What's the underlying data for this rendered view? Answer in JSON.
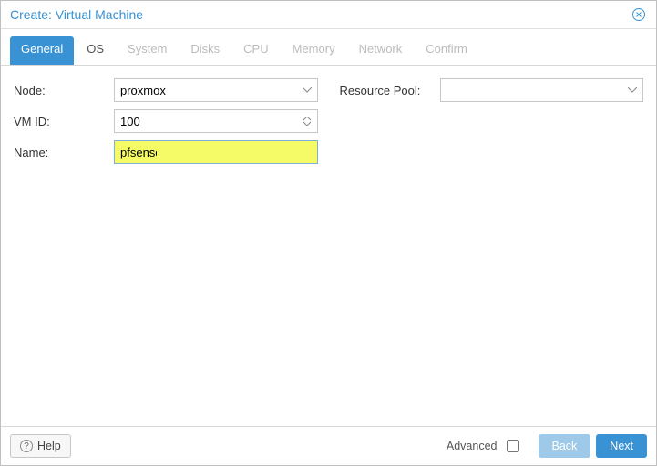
{
  "window": {
    "title": "Create: Virtual Machine"
  },
  "tabs": [
    {
      "label": "General",
      "active": true,
      "enabled": true
    },
    {
      "label": "OS",
      "active": false,
      "enabled": true
    },
    {
      "label": "System",
      "active": false,
      "enabled": false
    },
    {
      "label": "Disks",
      "active": false,
      "enabled": false
    },
    {
      "label": "CPU",
      "active": false,
      "enabled": false
    },
    {
      "label": "Memory",
      "active": false,
      "enabled": false
    },
    {
      "label": "Network",
      "active": false,
      "enabled": false
    },
    {
      "label": "Confirm",
      "active": false,
      "enabled": false
    }
  ],
  "form": {
    "node": {
      "label": "Node:",
      "value": "proxmox"
    },
    "vmid": {
      "label": "VM ID:",
      "value": "100"
    },
    "name": {
      "label": "Name:",
      "value": "pfsense"
    },
    "pool": {
      "label": "Resource Pool:",
      "value": ""
    }
  },
  "footer": {
    "help": "Help",
    "advanced": "Advanced",
    "advanced_checked": false,
    "back": "Back",
    "next": "Next"
  }
}
